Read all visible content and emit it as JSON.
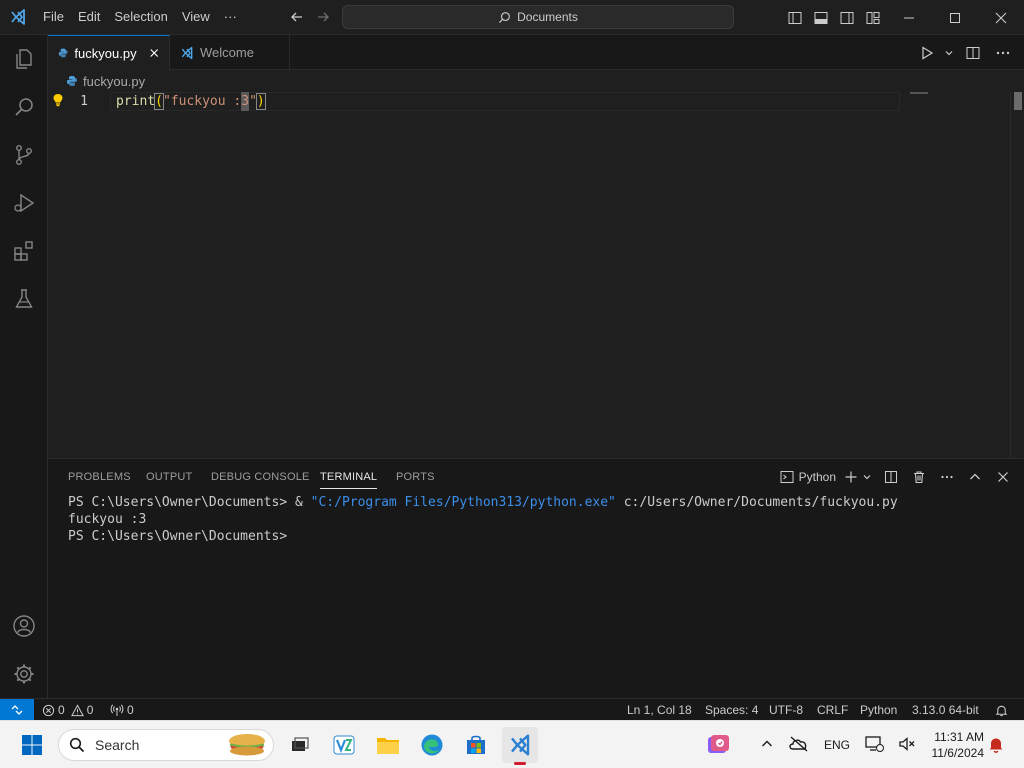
{
  "menu": [
    "File",
    "Edit",
    "Selection",
    "View",
    "···"
  ],
  "command_center": {
    "label": "Documents",
    "icon": "search-icon"
  },
  "tabs": [
    {
      "label": "fuckyou.py",
      "icon": "python-file-icon",
      "active": true
    },
    {
      "label": "Welcome",
      "icon": "vscode-logo-icon",
      "active": false
    }
  ],
  "breadcrumb": {
    "file": "fuckyou.py"
  },
  "editor": {
    "line_number": "1",
    "code": {
      "fn": "print",
      "open": "(",
      "str_before": "\"fuckyou :",
      "str_cursor": "3",
      "str_after": "\"",
      "close": ")"
    }
  },
  "panel": {
    "tabs": [
      "PROBLEMS",
      "OUTPUT",
      "DEBUG CONSOLE",
      "TERMINAL",
      "PORTS"
    ],
    "active_tab": "TERMINAL",
    "terminal_profile": "Python",
    "terminal": {
      "line1_prefix": "PS C:\\Users\\Owner\\Documents> & ",
      "line1_path": "\"C:/Program Files/Python313/python.exe\"",
      "line1_suffix": " c:/Users/Owner/Documents/fuckyou.py",
      "line2": "fuckyou :3",
      "line3": "PS C:\\Users\\Owner\\Documents>"
    }
  },
  "status": {
    "errors": "0",
    "warnings": "0",
    "ports": "0",
    "position": "Ln 1, Col 18",
    "spaces": "Spaces: 4",
    "encoding": "UTF-8",
    "eol": "CRLF",
    "language": "Python",
    "interpreter": "3.13.0 64-bit"
  },
  "taskbar": {
    "search_placeholder": "Search",
    "language": "ENG",
    "time": "11:31 AM",
    "date": "11/6/2024"
  },
  "colors": {
    "accent": "#0078d4",
    "bg": "#1f1f1f",
    "sidebar": "#181818"
  }
}
